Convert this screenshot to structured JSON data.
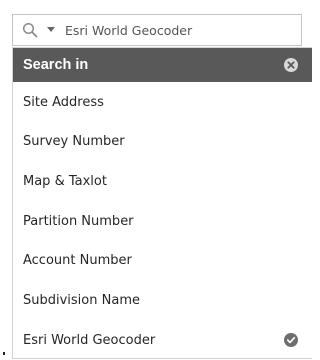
{
  "search": {
    "selected_provider": "Esri World Geocoder",
    "icon": "search-icon",
    "caret_icon": "caret-down-icon"
  },
  "dropdown": {
    "header": "Search in",
    "clear_icon": "close-circle-icon",
    "items": [
      {
        "label": "Site Address",
        "selected": false
      },
      {
        "label": "Survey Number",
        "selected": false
      },
      {
        "label": "Map & Taxlot",
        "selected": false
      },
      {
        "label": "Partition Number",
        "selected": false
      },
      {
        "label": "Account Number",
        "selected": false
      },
      {
        "label": "Subdivision Name",
        "selected": false
      },
      {
        "label": "Esri World Geocoder",
        "selected": true
      }
    ],
    "selected_icon": "check-circle-icon"
  },
  "colors": {
    "header_bg": "#595959",
    "header_text": "#ffffff",
    "item_text": "#262626",
    "border": "#c4c4c4",
    "icon_gray": "#6e6e6e"
  }
}
